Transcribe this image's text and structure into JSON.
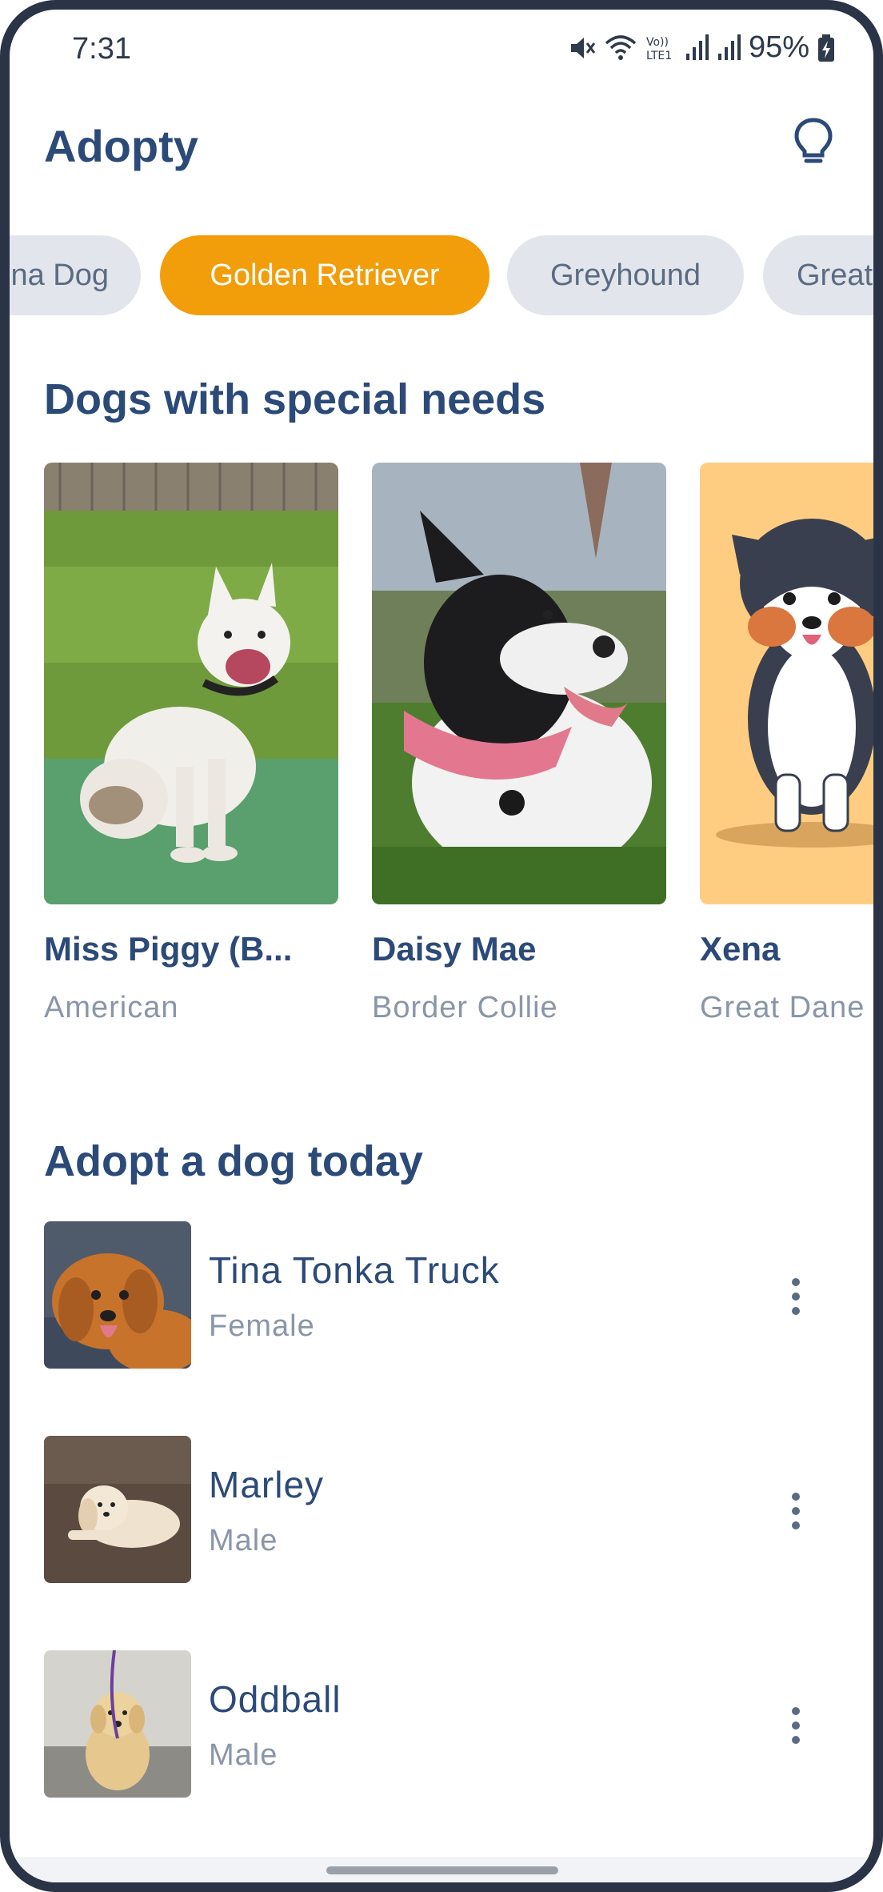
{
  "status_bar": {
    "time": "7:31",
    "battery": "95%",
    "icons": [
      "mute-icon",
      "wifi-icon",
      "volte-icon",
      "signal-icon",
      "signal-icon",
      "battery-charging-icon"
    ]
  },
  "app_bar": {
    "title": "Adopty",
    "action_icon": "lightbulb-icon"
  },
  "breed_chips": [
    {
      "label": "Alaska Dog",
      "visible_text": "na Dog",
      "selected": false
    },
    {
      "label": "Golden Retriever",
      "selected": true
    },
    {
      "label": "Greyhound",
      "selected": false
    },
    {
      "label": "Great Dane",
      "visible_text": "Great",
      "selected": false
    }
  ],
  "special_needs": {
    "title": "Dogs with special needs",
    "cards": [
      {
        "name": "Miss Piggy (B...",
        "breed": "American"
      },
      {
        "name": "Daisy Mae",
        "breed": "Border Collie"
      },
      {
        "name": "Xena",
        "breed": "Great Dane"
      }
    ]
  },
  "adopt": {
    "title": "Adopt a dog today",
    "items": [
      {
        "name": "Tina Tonka Truck",
        "sex": "Female"
      },
      {
        "name": "Marley",
        "sex": "Male"
      },
      {
        "name": "Oddball",
        "sex": "Male"
      }
    ]
  },
  "colors": {
    "primary": "#2c4a78",
    "accent": "#f29d0a",
    "chip_bg": "#e2e6ec",
    "secondary_text": "#8a96a8"
  }
}
